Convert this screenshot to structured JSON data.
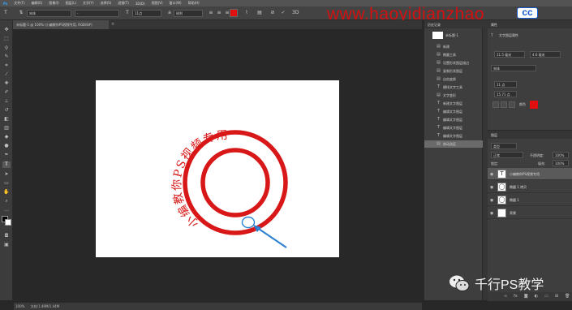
{
  "menu": [
    "文件(F)",
    "编辑(E)",
    "图像(I)",
    "图层(L)",
    "文字(Y)",
    "选择(S)",
    "滤镜(T)",
    "3D(D)",
    "视图(V)",
    "窗口(W)",
    "帮助(H)"
  ],
  "options": {
    "font_family": "宋体",
    "font_style": "-",
    "font_size": "11点",
    "anti_alias": "锐利"
  },
  "watermark": {
    "text": "www.haoyidianzhao",
    "cc": "cc"
  },
  "document_tab": {
    "title": "未标题-1 @ 100% (小编教你PS视频专用, RGB/8#)",
    "close": "×"
  },
  "canvas": {
    "stamp_text": "小编教你PS视频专用",
    "stamp_color": "#d81818",
    "arrow_color": "#2a7fd0"
  },
  "status": {
    "zoom": "100%",
    "doc_info": "文档:1.49M/1.44M"
  },
  "history": {
    "title": "历史记录",
    "snapshot": "未标题-1",
    "items": [
      "新建",
      "椭圆工具",
      "设置形状图层描边",
      "复制形状图层",
      "自由变换",
      "横排文字工具",
      "文字变形",
      "新建文字图层",
      "编辑文字图层",
      "编辑文字图层",
      "编辑文字图层",
      "编辑文字图层",
      "移动选区"
    ]
  },
  "properties": {
    "title": "属性",
    "type_label": "文字图层属性",
    "size_w": "11.5 毫米",
    "size_h": "4.6 毫米",
    "font": "宋体",
    "font_size": "11 点",
    "tracking": "15.71 点",
    "color_label": "颜色",
    "color": "#e01010"
  },
  "layers": {
    "title": "图层",
    "filter": "类型",
    "blend": "正常",
    "opacity_label": "不透明度:",
    "opacity": "100%",
    "lock_label": "锁定:",
    "fill_label": "填充:",
    "fill": "100%",
    "items": [
      {
        "name": "小编教你PS视频专用",
        "kind": "T"
      },
      {
        "name": "椭圆 1 拷贝",
        "kind": "◯"
      },
      {
        "name": "椭圆 1",
        "kind": "◯"
      },
      {
        "name": "背景",
        "kind": ""
      }
    ]
  },
  "brand": {
    "text": "千行PS教学"
  }
}
